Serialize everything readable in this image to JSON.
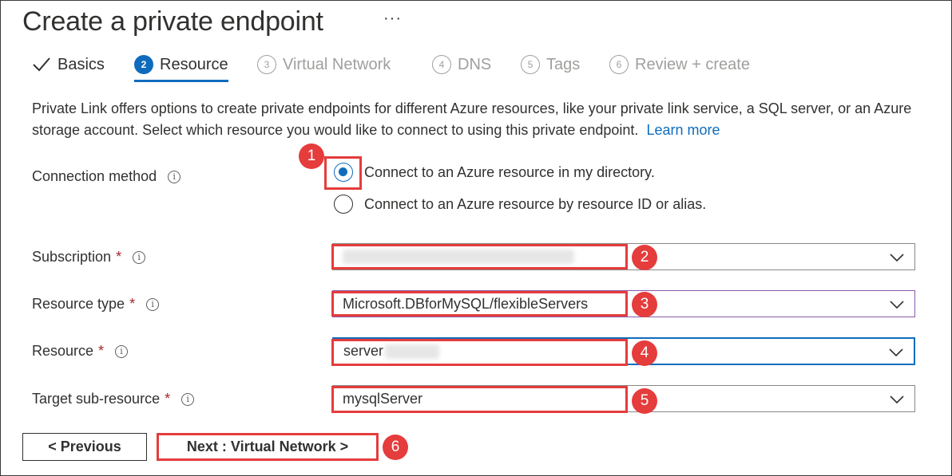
{
  "header": {
    "title": "Create a private endpoint",
    "more_label": "···"
  },
  "tabs": [
    {
      "num": "",
      "label": "Basics",
      "state": "completed"
    },
    {
      "num": "2",
      "label": "Resource",
      "state": "active"
    },
    {
      "num": "3",
      "label": "Virtual Network",
      "state": "disabled"
    },
    {
      "num": "4",
      "label": "DNS",
      "state": "disabled"
    },
    {
      "num": "5",
      "label": "Tags",
      "state": "disabled"
    },
    {
      "num": "6",
      "label": "Review + create",
      "state": "disabled"
    }
  ],
  "description": {
    "text": "Private Link offers options to create private endpoints for different Azure resources, like your private link service, a SQL server, or an Azure storage account. Select which resource you would like to connect to using this private endpoint.",
    "link": "Learn more"
  },
  "connection_method": {
    "label": "Connection method",
    "options": [
      {
        "label": "Connect to an Azure resource in my directory.",
        "selected": true
      },
      {
        "label": "Connect to an Azure resource by resource ID or alias.",
        "selected": false
      }
    ]
  },
  "fields": {
    "subscription": {
      "label": "Subscription",
      "required_mark": "*",
      "value": ""
    },
    "resource_type": {
      "label": "Resource type",
      "required_mark": "*",
      "value": "Microsoft.DBforMySQL/flexibleServers"
    },
    "resource": {
      "label": "Resource",
      "required_mark": "*",
      "value": "server"
    },
    "target_sub_resource": {
      "label": "Target sub-resource",
      "required_mark": "*",
      "value": "mysqlServer"
    }
  },
  "buttons": {
    "previous": "< Previous",
    "next": "Next : Virtual Network >"
  },
  "annotations": [
    "1",
    "2",
    "3",
    "4",
    "5",
    "6"
  ],
  "colors": {
    "accent": "#0f6cbd",
    "annotation": "#e53c3c",
    "required": "#a4262c",
    "disabled_text": "#a19f9d"
  }
}
